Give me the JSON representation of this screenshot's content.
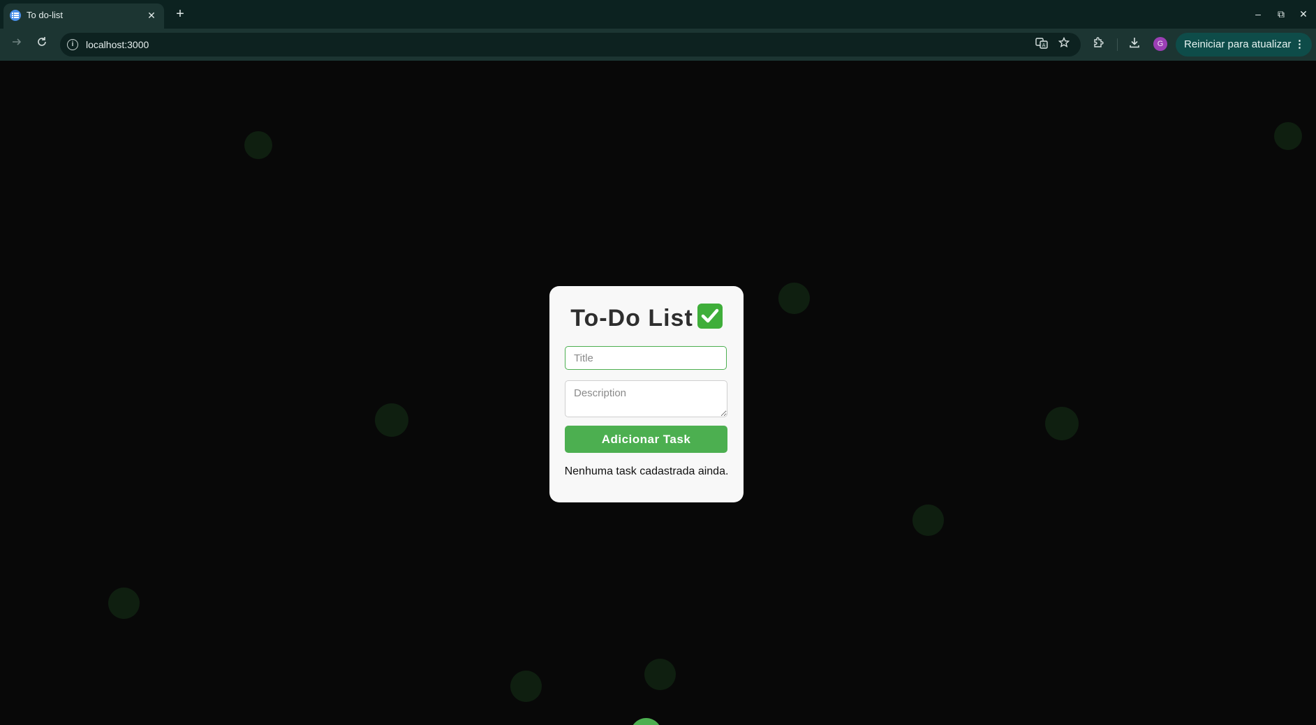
{
  "browser": {
    "tab": {
      "title": "To do-list",
      "favicon": "list-favicon-icon"
    },
    "new_tab_symbol": "+",
    "close_symbol": "✕",
    "window_controls": {
      "minimize": "–",
      "maximize": "⧉",
      "close": "✕"
    },
    "address": {
      "url": "localhost:3000",
      "info_symbol": "i"
    },
    "icons": [
      "back-arrow-icon",
      "reload-icon",
      "translate-icon",
      "bookmark-star-icon",
      "extensions-icon",
      "download-icon"
    ],
    "profile_initial": "G",
    "update_button": {
      "label": "Reiniciar para atualizar",
      "menu": "⋮"
    }
  },
  "app": {
    "title": "To-Do List",
    "title_icon": "check-mark-icon",
    "title_placeholder": "Title",
    "description_placeholder": "Description",
    "add_button_label": "Adicionar Task",
    "empty_message": "Nenhuma task cadastrada ainda.",
    "accent_color": "#4caf50"
  }
}
